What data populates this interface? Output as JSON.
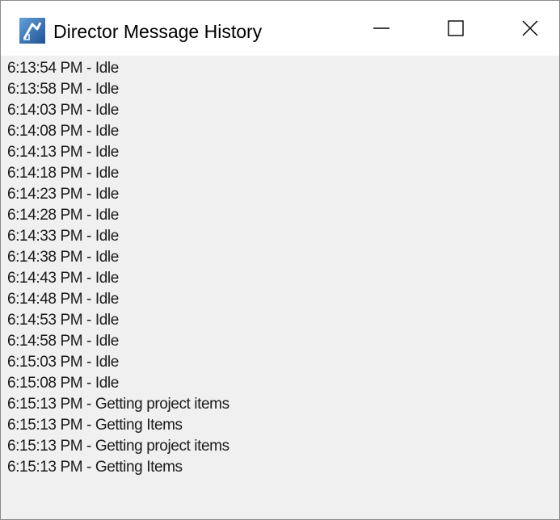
{
  "window": {
    "title": "Director Message History",
    "icon": "director-app-icon",
    "buttons": {
      "minimize": "minimize-icon",
      "maximize": "maximize-icon",
      "close": "close-icon"
    }
  },
  "log": {
    "entries": [
      "6:13:54 PM - Idle",
      "6:13:58 PM - Idle",
      "6:14:03 PM - Idle",
      "6:14:08 PM - Idle",
      "6:14:13 PM - Idle",
      "6:14:18 PM - Idle",
      "6:14:23 PM - Idle",
      "6:14:28 PM - Idle",
      "6:14:33 PM - Idle",
      "6:14:38 PM - Idle",
      "6:14:43 PM - Idle",
      "6:14:48 PM - Idle",
      "6:14:53 PM - Idle",
      "6:14:58 PM - Idle",
      "6:15:03 PM - Idle",
      "6:15:08 PM - Idle",
      "6:15:13 PM - Getting project items",
      "6:15:13 PM - Getting Items",
      "6:15:13 PM - Getting project items",
      "6:15:13 PM - Getting Items"
    ]
  },
  "colors": {
    "titlebar_bg": "#ffffff",
    "client_bg": "#f0f0f0",
    "text": "#1a1a1a",
    "icon_blue": "#2f6fb5"
  }
}
